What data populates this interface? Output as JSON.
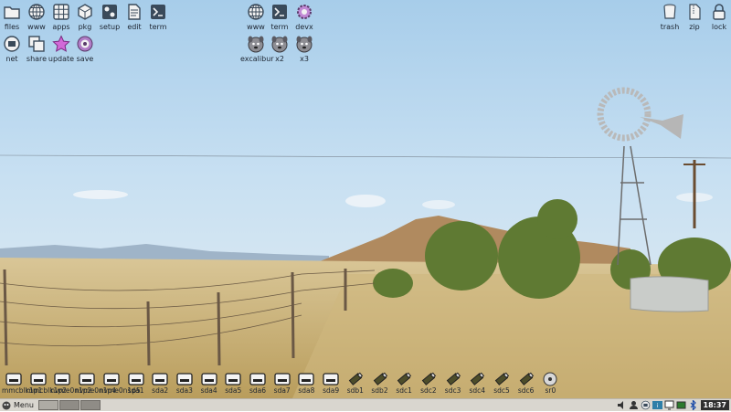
{
  "desktop": {
    "top_left_icons": [
      {
        "label": "files",
        "icon": "folder-icon"
      },
      {
        "label": "www",
        "icon": "globe-icon"
      },
      {
        "label": "apps",
        "icon": "grid-icon"
      },
      {
        "label": "pkg",
        "icon": "package-icon"
      },
      {
        "label": "setup",
        "icon": "setup-icon"
      },
      {
        "label": "edit",
        "icon": "document-icon"
      },
      {
        "label": "term",
        "icon": "terminal-icon"
      },
      {
        "label": "net",
        "icon": "network-icon"
      },
      {
        "label": "share",
        "icon": "share-icon"
      },
      {
        "label": "update",
        "icon": "star-icon"
      },
      {
        "label": "save",
        "icon": "target-icon"
      }
    ],
    "center_icons": [
      {
        "label": "www",
        "icon": "globe-icon"
      },
      {
        "label": "term",
        "icon": "terminal-icon"
      },
      {
        "label": "devx",
        "icon": "gear-icon"
      },
      {
        "label": "excalibur",
        "icon": "puppy-icon"
      },
      {
        "label": "x2",
        "icon": "puppy-icon"
      },
      {
        "label": "x3",
        "icon": "puppy-icon"
      }
    ],
    "top_right_icons": [
      {
        "label": "trash",
        "icon": "trash-icon"
      },
      {
        "label": "zip",
        "icon": "zip-icon"
      },
      {
        "label": "lock",
        "icon": "lock-icon"
      }
    ],
    "drives": [
      {
        "label": "mmcblk1p1",
        "type": "drive"
      },
      {
        "label": "mmcblk1p2",
        "type": "drive"
      },
      {
        "label": "nvme0n1p2",
        "type": "drive"
      },
      {
        "label": "nvme0n1p4",
        "type": "drive"
      },
      {
        "label": "nvme0n1p5",
        "type": "drive"
      },
      {
        "label": "sda1",
        "type": "drive"
      },
      {
        "label": "sda2",
        "type": "drive"
      },
      {
        "label": "sda3",
        "type": "drive"
      },
      {
        "label": "sda4",
        "type": "drive"
      },
      {
        "label": "sda5",
        "type": "drive"
      },
      {
        "label": "sda6",
        "type": "drive"
      },
      {
        "label": "sda7",
        "type": "drive"
      },
      {
        "label": "sda8",
        "type": "drive"
      },
      {
        "label": "sda9",
        "type": "drive"
      },
      {
        "label": "sdb1",
        "type": "usb"
      },
      {
        "label": "sdb2",
        "type": "usb"
      },
      {
        "label": "sdc1",
        "type": "usb"
      },
      {
        "label": "sdc2",
        "type": "usb"
      },
      {
        "label": "sdc3",
        "type": "usb"
      },
      {
        "label": "sdc4",
        "type": "usb"
      },
      {
        "label": "sdc5",
        "type": "usb"
      },
      {
        "label": "sdc6",
        "type": "usb"
      },
      {
        "label": "sr0",
        "type": "optical"
      }
    ]
  },
  "taskbar": {
    "menu_label": "Menu",
    "clock": "18:37",
    "tray_icons": [
      "speaker-icon",
      "user-icon",
      "network-icon",
      "info-icon",
      "monitor-icon",
      "battery-icon",
      "bluetooth-icon"
    ]
  }
}
